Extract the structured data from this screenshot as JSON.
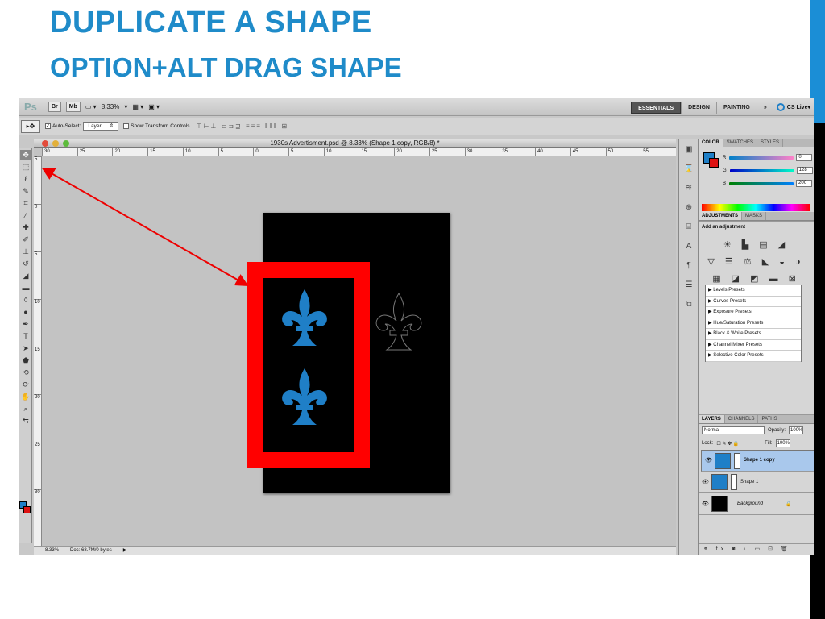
{
  "slide": {
    "title": "DUPLICATE A SHAPE",
    "subtitle": "OPTION+ALT DRAG SHAPE"
  },
  "app": {
    "logo": "Ps",
    "zoom": "8.33%",
    "workspaces": [
      "ESSENTIALS",
      "DESIGN",
      "PAINTING"
    ],
    "more": "»",
    "cslive": "CS Live"
  },
  "options": {
    "auto_select_label": "Auto-Select:",
    "auto_select_value": "Layer",
    "show_transform_label": "Show Transform Controls"
  },
  "document": {
    "title": "1930s Advertisment.psd @ 8.33% (Shape 1 copy, RGB/8) *",
    "ruler_h": [
      "30",
      "25",
      "20",
      "15",
      "10",
      "5",
      "0",
      "5",
      "10",
      "15",
      "20",
      "25",
      "30",
      "35",
      "40",
      "45",
      "50",
      "55"
    ],
    "ruler_v": [
      "5",
      "0",
      "5",
      "10",
      "15",
      "20",
      "25",
      "30"
    ],
    "status_zoom": "8.33%",
    "status_doc": "Doc: 68.7M/0 bytes"
  },
  "colors": {
    "accent": "#1f8bc9",
    "fleur": "#1f7fc7",
    "frame": "#ff0000"
  },
  "color_panel": {
    "tabs": [
      "COLOR",
      "SWATCHES",
      "STYLES"
    ],
    "r": "0",
    "g": "128",
    "b": "200",
    "r_label": "R",
    "g_label": "G",
    "b_label": "B"
  },
  "adjustments": {
    "tabs": [
      "ADJUSTMENTS",
      "MASKS"
    ],
    "heading": "Add an adjustment",
    "presets": [
      "Levels Presets",
      "Curves Presets",
      "Exposure Presets",
      "Hue/Saturation Presets",
      "Black & White Presets",
      "Channel Mixer Presets",
      "Selective Color Presets"
    ]
  },
  "layers": {
    "tabs": [
      "LAYERS",
      "CHANNELS",
      "PATHS"
    ],
    "mode": "Normal",
    "opacity_label": "Opacity:",
    "opacity": "100%",
    "lock_label": "Lock:",
    "fill_label": "Fill:",
    "fill": "100%",
    "items": [
      "Shape 1 copy",
      "Shape 1",
      "Background"
    ]
  }
}
